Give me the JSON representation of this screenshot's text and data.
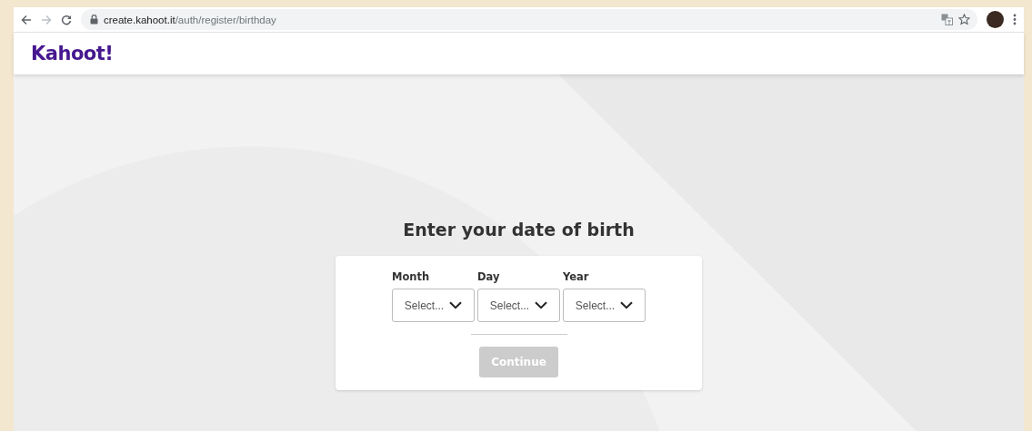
{
  "browser": {
    "url": {
      "host": "create.kahoot.it",
      "path": "/auth/register/birthday"
    }
  },
  "header": {
    "logo": "Kahoot!"
  },
  "form": {
    "title": "Enter your date of birth",
    "fields": [
      {
        "label": "Month",
        "placeholder": "Select..."
      },
      {
        "label": "Day",
        "placeholder": "Select..."
      },
      {
        "label": "Year",
        "placeholder": "Select..."
      }
    ],
    "continue_button": {
      "label": "Continue",
      "disabled": true
    }
  }
}
